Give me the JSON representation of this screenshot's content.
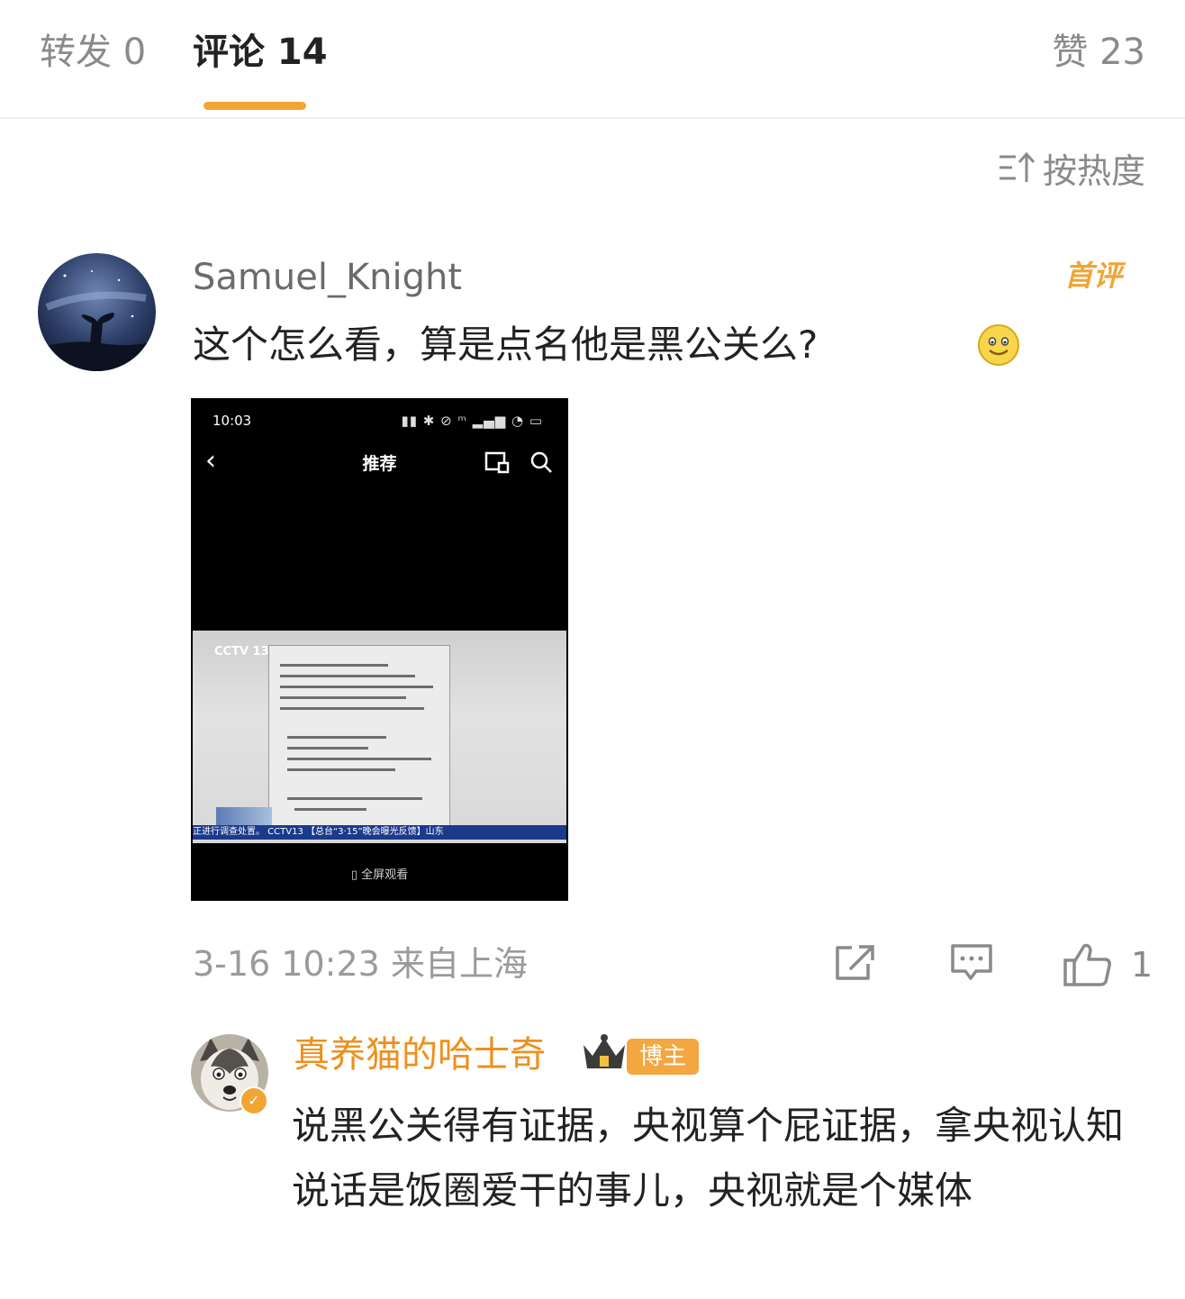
{
  "tabs": {
    "repost": "转发 0",
    "comments": "评论 14",
    "likes": "赞 23"
  },
  "sort": {
    "label": "按热度",
    "icon": "sort-icon"
  },
  "comment": {
    "username": "Samuel_Knight",
    "badge": "首评",
    "text": "这个怎么看，算是点名他是黑公关么?",
    "emoji": "smile-emoji",
    "media": {
      "status_time": "10:03",
      "status_icons": "▮▮ ✱ ⊘ ᵐ ▂▄▆ ◔ ▭",
      "back_glyph": "‹",
      "title": "推荐",
      "video_channel": "CCTV 13",
      "ticker": "正进行调查处置。 CCTV13 【总台“3·15”晚会曝光反馈】山东",
      "fullscreen": "▯ 全屏观看"
    },
    "timestamp": "3-16 10:23",
    "location": "来自上海",
    "like_count": "1"
  },
  "reply": {
    "username": "真养猫的哈士奇",
    "badge": "博主",
    "text": "说黑公关得有证据，央视算个屁证据，拿央视认知说话是饭圈爱干的事儿，央视就是个媒体"
  },
  "colors": {
    "accent": "#f0a535",
    "reply_name": "#ef8f1c",
    "muted": "#8a8a8a"
  }
}
